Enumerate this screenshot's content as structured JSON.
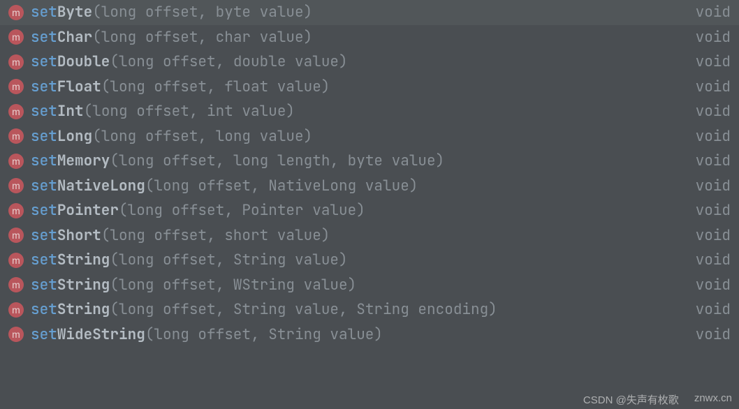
{
  "icon_letter": "m",
  "items": [
    {
      "selected": true,
      "prefix": "set",
      "name": "Byte",
      "params": "(long offset, byte value)",
      "ret": "void"
    },
    {
      "selected": false,
      "prefix": "set",
      "name": "Char",
      "params": "(long offset, char value)",
      "ret": "void"
    },
    {
      "selected": false,
      "prefix": "set",
      "name": "Double",
      "params": "(long offset, double value)",
      "ret": "void"
    },
    {
      "selected": false,
      "prefix": "set",
      "name": "Float",
      "params": "(long offset, float value)",
      "ret": "void"
    },
    {
      "selected": false,
      "prefix": "set",
      "name": "Int",
      "params": "(long offset, int value)",
      "ret": "void"
    },
    {
      "selected": false,
      "prefix": "set",
      "name": "Long",
      "params": "(long offset, long value)",
      "ret": "void"
    },
    {
      "selected": false,
      "prefix": "set",
      "name": "Memory",
      "params": "(long offset, long length, byte value)",
      "ret": "void"
    },
    {
      "selected": false,
      "prefix": "set",
      "name": "NativeLong",
      "params": "(long offset, NativeLong value)",
      "ret": "void"
    },
    {
      "selected": false,
      "prefix": "set",
      "name": "Pointer",
      "params": "(long offset, Pointer value)",
      "ret": "void"
    },
    {
      "selected": false,
      "prefix": "set",
      "name": "Short",
      "params": "(long offset, short value)",
      "ret": "void"
    },
    {
      "selected": false,
      "prefix": "set",
      "name": "String",
      "params": "(long offset, String value)",
      "ret": "void"
    },
    {
      "selected": false,
      "prefix": "set",
      "name": "String",
      "params": "(long offset, WString value)",
      "ret": "void"
    },
    {
      "selected": false,
      "prefix": "set",
      "name": "String",
      "params": "(long offset, String value, String encoding)",
      "ret": "void"
    },
    {
      "selected": false,
      "prefix": "set",
      "name": "WideString",
      "params": "(long offset, String value)",
      "ret": "void"
    }
  ],
  "watermark": {
    "left": "CSDN @失声有枚歌",
    "right": "znwx.cn"
  }
}
